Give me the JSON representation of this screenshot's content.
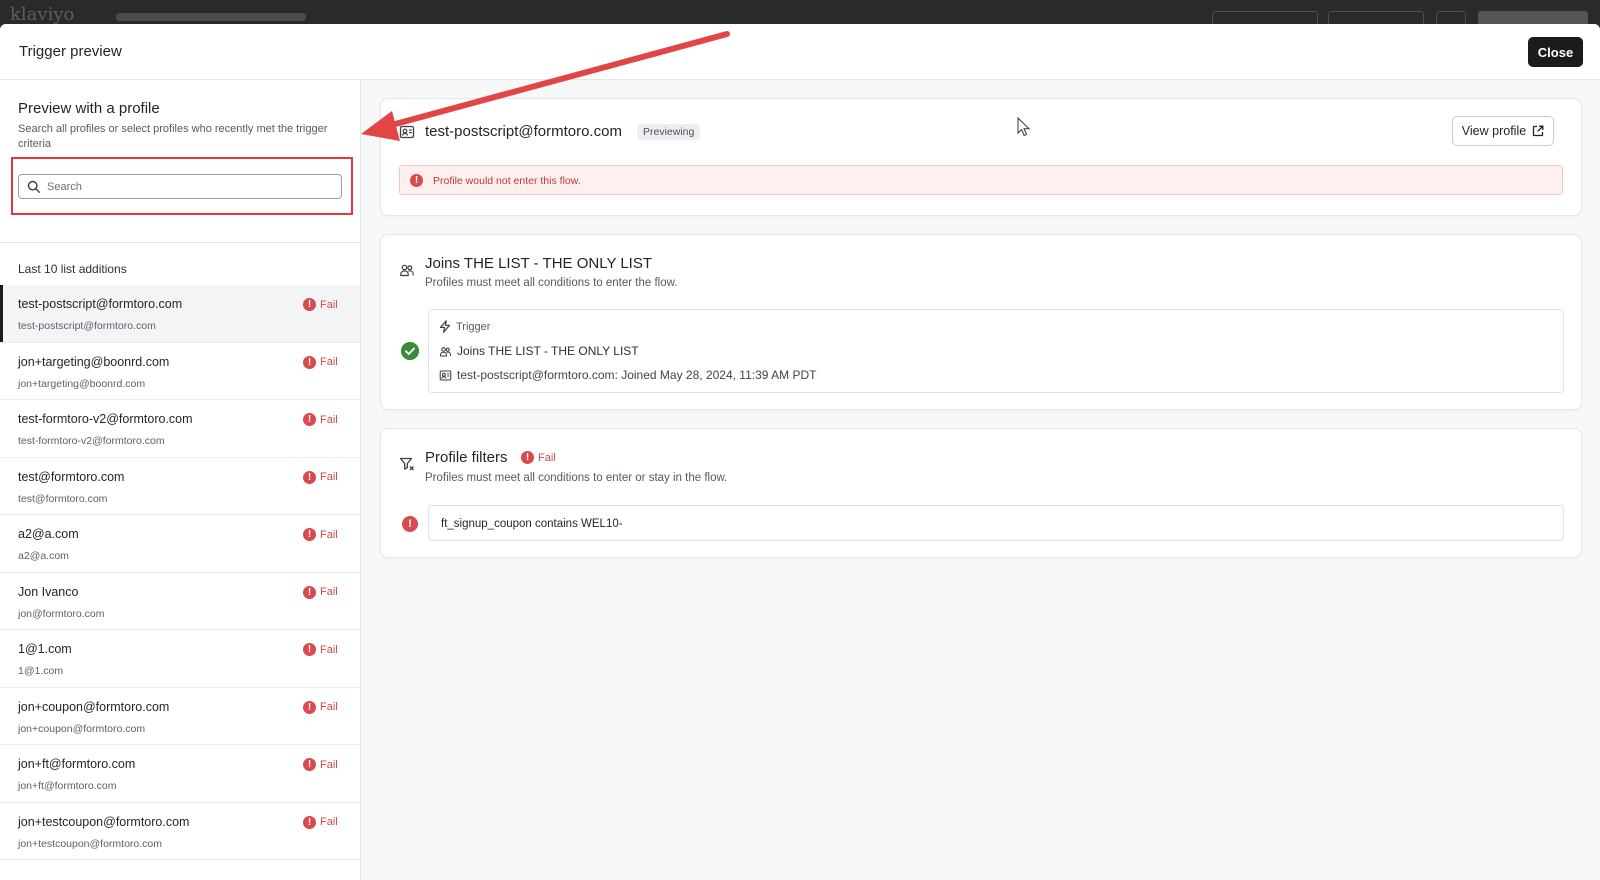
{
  "background_app": {
    "logo": "klaviyo"
  },
  "modal": {
    "title": "Trigger preview",
    "close_label": "Close"
  },
  "sidebar": {
    "title": "Preview with a profile",
    "subtitle": "Search all profiles or select profiles who recently met the trigger criteria",
    "search": {
      "placeholder": "Search",
      "value": ""
    },
    "list_heading": "Last 10 list additions",
    "items": [
      {
        "name": "test-postscript@formtoro.com",
        "email": "test-postscript@formtoro.com",
        "status": "Fail",
        "selected": true
      },
      {
        "name": "jon+targeting@boonrd.com",
        "email": "jon+targeting@boonrd.com",
        "status": "Fail"
      },
      {
        "name": "test-formtoro-v2@formtoro.com",
        "email": "test-formtoro-v2@formtoro.com",
        "status": "Fail"
      },
      {
        "name": "test@formtoro.com",
        "email": "test@formtoro.com",
        "status": "Fail"
      },
      {
        "name": "a2@a.com",
        "email": "a2@a.com",
        "status": "Fail"
      },
      {
        "name": "Jon Ivanco",
        "email": "jon@formtoro.com",
        "status": "Fail"
      },
      {
        "name": "1@1.com",
        "email": "1@1.com",
        "status": "Fail"
      },
      {
        "name": "jon+coupon@formtoro.com",
        "email": "jon+coupon@formtoro.com",
        "status": "Fail"
      },
      {
        "name": "jon+ft@formtoro.com",
        "email": "jon+ft@formtoro.com",
        "status": "Fail"
      },
      {
        "name": "jon+testcoupon@formtoro.com",
        "email": "jon+testcoupon@formtoro.com",
        "status": "Fail"
      }
    ]
  },
  "profile_card": {
    "email": "test-postscript@formtoro.com",
    "badge": "Previewing",
    "view_profile_label": "View profile",
    "alert": "Profile would not enter this flow."
  },
  "trigger_card": {
    "title": "Joins THE LIST - THE ONLY LIST",
    "subtitle": "Profiles must meet all conditions to enter the flow.",
    "box_label": "Trigger",
    "box_list": "Joins THE LIST - THE ONLY LIST",
    "box_event": "test-postscript@formtoro.com: Joined May 28, 2024, 11:39 AM PDT"
  },
  "filters_card": {
    "title": "Profile filters",
    "status": "Fail",
    "subtitle": "Profiles must meet all conditions to enter or stay in the flow.",
    "condition": "ft_signup_coupon contains WEL10-"
  },
  "colors": {
    "fail": "#d94a4f",
    "success": "#3a8a3c",
    "annotation": "#e0383e",
    "primary_button": "#1b1b1b"
  },
  "icons": {
    "search": "search-icon",
    "error": "error-circle-icon",
    "check": "check-circle-icon",
    "profile": "profile-card-icon",
    "list": "users-icon",
    "trigger": "lightning-icon",
    "filter": "filter-icon",
    "external": "external-link-icon"
  }
}
